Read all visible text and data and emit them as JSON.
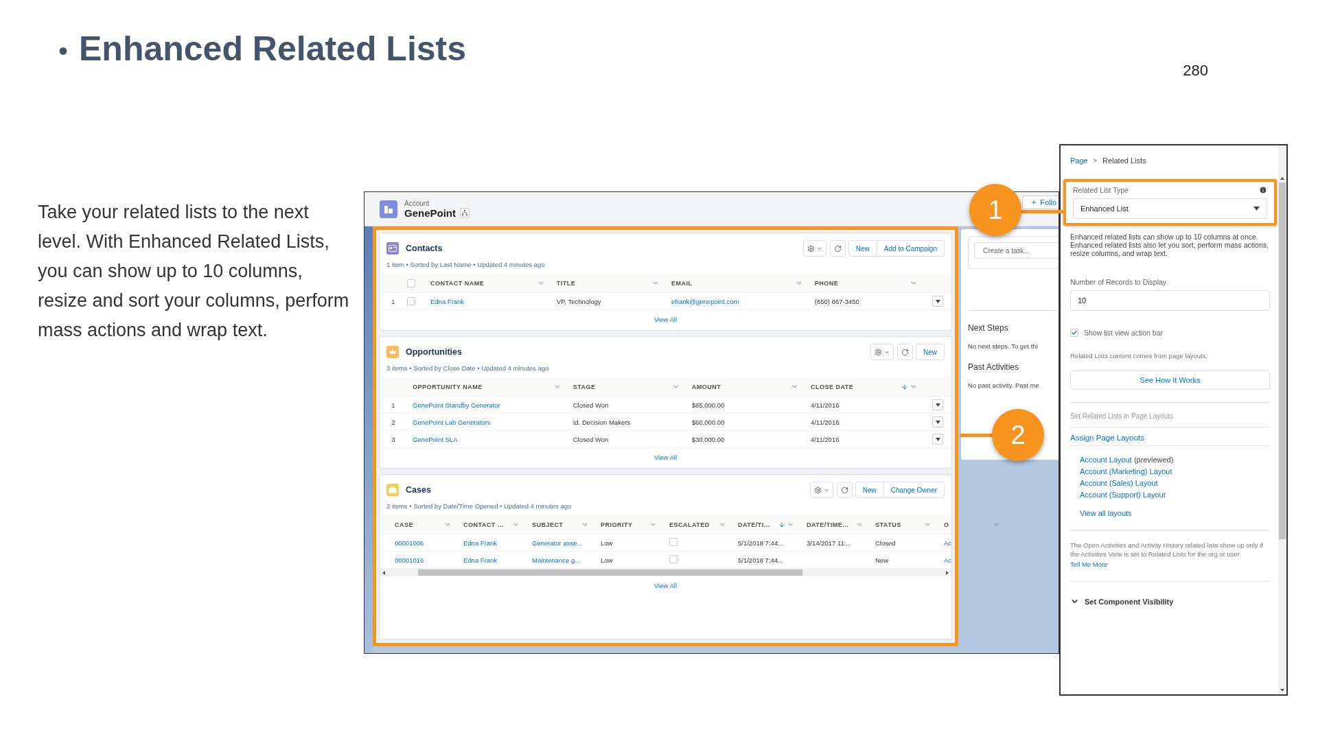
{
  "slide": {
    "bullet": "•",
    "title": "Enhanced Related Lists",
    "page_number": "280",
    "body": "Take your related lists to the next level. With Enhanced Related Lists, you can show up to 10 columns, resize and sort your columns, perform mass actions and wrap text."
  },
  "record": {
    "object": "Account",
    "name": "GenePoint",
    "follow": "Follo"
  },
  "related_lists": [
    {
      "kind": "contacts",
      "color": "#8b85d8",
      "title": "Contacts",
      "all_selected": false,
      "summary": "1 item • Sorted by Last Name • Updated 4 minutes ago",
      "actions": [
        "New",
        "Add to Campaign"
      ],
      "columns": [
        {
          "label": "CONTACT NAME",
          "sorted": false,
          "kind": "link"
        },
        {
          "label": "TITLE",
          "sorted": false,
          "kind": "text"
        },
        {
          "label": "EMAIL",
          "sorted": false,
          "kind": "link"
        },
        {
          "label": "PHONE",
          "sorted": false,
          "kind": "text"
        }
      ],
      "rows": [
        {
          "number": "1",
          "selected": false,
          "cells": [
            "Edna Frank",
            "VP, Technology",
            "efrank@genepoint.com",
            "(650) 867-3450"
          ]
        }
      ],
      "view_all": "View All"
    },
    {
      "kind": "opportunities",
      "color": "#fcb95b",
      "title": "Opportunities",
      "summary": "3 items • Sorted by Close Date • Updated 4 minutes ago",
      "actions": [
        "New"
      ],
      "columns": [
        {
          "label": "OPPORTUNITY NAME",
          "sorted": false,
          "kind": "link"
        },
        {
          "label": "STAGE",
          "sorted": false,
          "kind": "text"
        },
        {
          "label": "AMOUNT",
          "sorted": false,
          "kind": "text"
        },
        {
          "label": "CLOSE DATE",
          "sorted": true,
          "kind": "text"
        }
      ],
      "rows": [
        {
          "number": "1",
          "cells": [
            "GenePoint Standby Generator",
            "Closed Won",
            "$85,000.00",
            "4/11/2016"
          ]
        },
        {
          "number": "2",
          "cells": [
            "GenePoint Lab Generators",
            "Id. Decision Makers",
            "$60,000.00",
            "4/11/2016"
          ]
        },
        {
          "number": "3",
          "cells": [
            "GenePoint SLA",
            "Closed Won",
            "$30,000.00",
            "4/11/2016"
          ]
        }
      ],
      "view_all": "View All"
    },
    {
      "kind": "cases",
      "color": "#f2cf5b",
      "title": "Cases",
      "summary": "2 items • Sorted by Date/Time Opened • Updated 4 minutes ago",
      "actions": [
        "New",
        "Change Owner"
      ],
      "columns": [
        {
          "label": "CASE",
          "sorted": false,
          "kind": "link"
        },
        {
          "label": "CONTACT ...",
          "sorted": false,
          "kind": "link"
        },
        {
          "label": "SUBJECT",
          "sorted": false,
          "kind": "link"
        },
        {
          "label": "PRIORITY",
          "sorted": false,
          "kind": "text"
        },
        {
          "label": "ESCALATED",
          "sorted": false,
          "kind": "checkbox"
        },
        {
          "label": "DATE/TI...",
          "sorted": true,
          "kind": "text"
        },
        {
          "label": "DATE/TIME...",
          "sorted": false,
          "kind": "text"
        },
        {
          "label": "STATUS",
          "sorted": false,
          "kind": "text"
        },
        {
          "label": "O",
          "sorted": false,
          "kind": "link"
        }
      ],
      "rows": [
        {
          "cells": [
            "00001006",
            "Edna Frank",
            "Generator asse...",
            "Low",
            {
              "checked": false
            },
            "5/1/2018 7:44...",
            "3/14/2017 11:...",
            "Closed",
            "Ac"
          ]
        },
        {
          "cells": [
            "00001016",
            "Edna Frank",
            "Maintenance g...",
            "Low",
            {
              "checked": false
            },
            "5/1/2018 7:44...",
            null,
            "New",
            "Ac"
          ]
        }
      ],
      "view_all": "View All"
    }
  ],
  "activity": {
    "task_placeholder": "Create a task...",
    "sections": [
      {
        "title": "Next Steps",
        "text": "No next steps. To get thi"
      },
      {
        "title": "Past Activities",
        "text": "No past activity. Past me"
      }
    ]
  },
  "panel": {
    "breadcrumb": [
      {
        "label": "Page",
        "link": true
      },
      {
        "label": "Related Lists",
        "link": false
      }
    ],
    "separator": ">",
    "type_field": {
      "label": "Related List Type",
      "value": "Enhanced List"
    },
    "type_help": "Enhanced related lists can show up to 10 columns at once. Enhanced related lists also let you sort, perform mass actions, resize columns, and wrap text.",
    "records_field": {
      "label": "Number of Records to Display",
      "value": "10"
    },
    "action_bar": {
      "label": "Show list view action bar",
      "checked": true
    },
    "layouts_note": "Related Lists content comes from page layouts.",
    "how_button": "See How It Works",
    "layouts_heading": "Set Related Lists in Page Layouts",
    "assign_link": "Assign Page Layouts",
    "layouts": [
      {
        "label": "Account Layout",
        "note": "(previewed)"
      },
      {
        "label": "Account (Marketing) Layout"
      },
      {
        "label": "Account (Sales) Layout"
      },
      {
        "label": "Account (Support) Layout"
      }
    ],
    "view_all_layouts": "View all layouts",
    "activities_note": "The Open Activities and Activity History related lists show up only if the Activities View is set to Related Lists for the org or user.",
    "activities_link": "Tell Me More",
    "visibility": "Set Component Visibility"
  },
  "callouts": [
    {
      "number": "1"
    },
    {
      "number": "2"
    }
  ]
}
